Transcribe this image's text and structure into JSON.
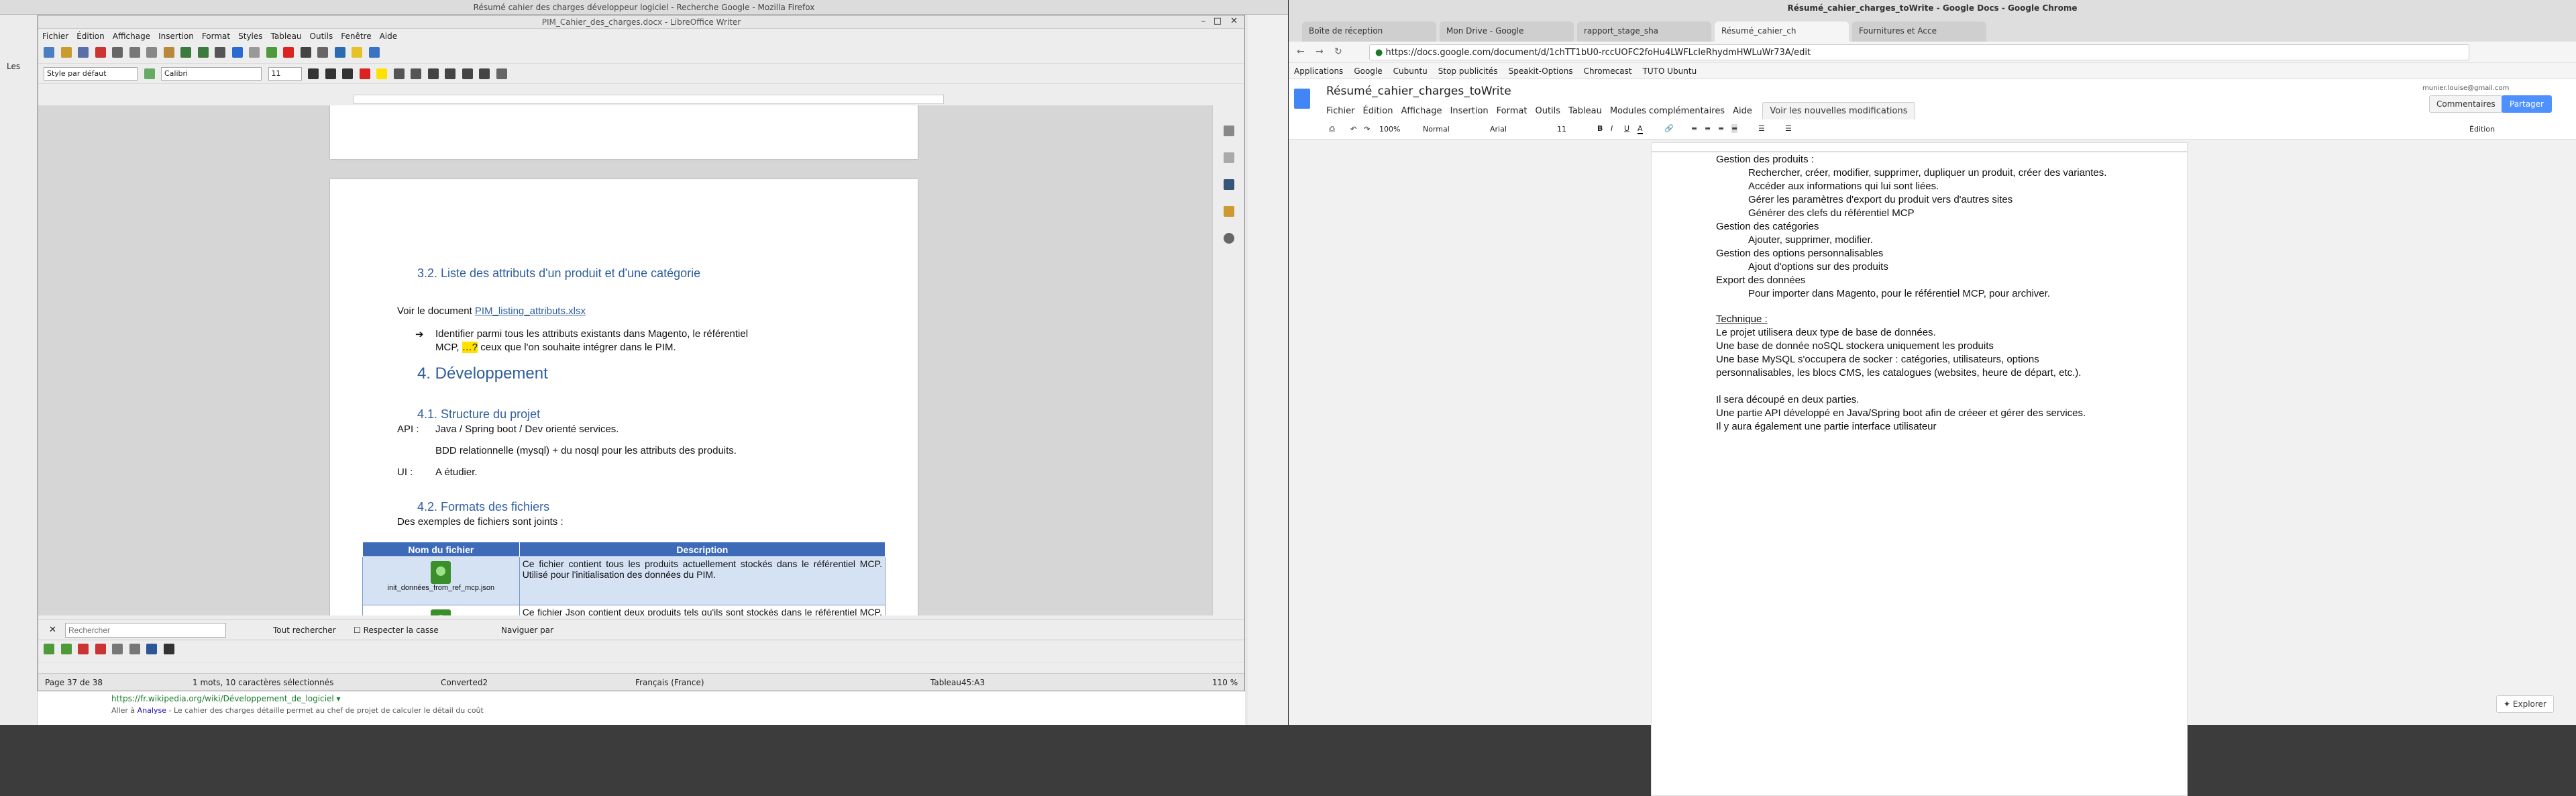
{
  "firefox": {
    "title": "Résumé cahier des charges développeur logiciel - Recherche Google - Mozilla Firefox",
    "sidebar_label": "Les",
    "result_url": "https://fr.wikipedia.org/wiki/Développement_de_logiciel ▾",
    "result_crumb_prefix": "Aller à",
    "result_crumb_link": "Analyse",
    "result_crumb_text": "- Le cahier des charges détaille permet au chef de projet de calculer le détail du coût"
  },
  "writer": {
    "title": "PIM_Cahier_des_charges.docx - LibreOffice Writer",
    "menu": [
      "Fichier",
      "Édition",
      "Affichage",
      "Insertion",
      "Format",
      "Styles",
      "Tableau",
      "Outils",
      "Fenêtre",
      "Aide"
    ],
    "style_value": "Style par défaut",
    "font_value": "Calibri",
    "size_value": "11",
    "doc": {
      "h_32": "3.2.        Liste des attributs d'un produit et d'une catégorie",
      "voir_prefix": "Voir le document ",
      "voir_link": "PIM_listing_attributs.xlsx",
      "arrow": "➔",
      "bullet_1": "Identifier parmi tous les attributs existants dans Magento, le référentiel",
      "bullet_2a": "MCP, ",
      "bullet_2b": "…?",
      "bullet_2c": " ceux que l'on souhaite intégrer dans le PIM.",
      "h_4": "4. Développement",
      "h_41": "4.1.        Structure du projet",
      "api_label": "API :",
      "api_text": "Java / Spring boot / Dev orienté services.",
      "bdd_text": "BDD relationnelle (mysql) + du nosql pour les attributs des produits.",
      "ui_label": "UI :",
      "ui_text": "A étudier.",
      "h_42": "4.2.        Formats des fichiers",
      "ex_text": "Des exemples de fichiers sont joints :",
      "table_headers": [
        "Nom du fichier",
        "Description"
      ],
      "row1_file": "init_données_from_ref_mcp.json",
      "row1_desc": "Ce fichier contient tous les produits actuellement stockés dans le référentiel MCP. Utilisé pour l'initialisation des données du PIM.",
      "row2_desc": "Ce fichier Json contient deux produits tels qu'ils sont stockés dans le référentiel MCP. Permet de connaitre"
    },
    "find": {
      "placeholder": "Rechercher",
      "all": "Tout rechercher",
      "case": "Respecter la casse",
      "nav": "Naviguer par"
    },
    "status": {
      "page": "Page 37 de 38",
      "words": "1 mots, 10 caractères sélectionnés",
      "style": "Converted2",
      "lang": "Français (France)",
      "cell": "Tableau45:A3",
      "zoom": "110 %"
    }
  },
  "chrome": {
    "title": "Résumé_cahier_charges_toWrite - Google Docs - Google Chrome",
    "tabs": [
      "Boîte de réception",
      "Mon Drive - Google",
      "rapport_stage_sha",
      "Résumé_cahier_ch",
      "Fournitures et Acce"
    ],
    "active_tab": 3,
    "url": "https://docs.google.com/document/d/1chTT1bU0-rccUOFC2foHu4LWFLcIeRhydmHWLuWr73A/edit",
    "bookmarks": [
      "Applications",
      "Google",
      "Cubuntu",
      "Stop publicités",
      "Speakit-Options",
      "Chromecast",
      "TUTO Ubuntu"
    ],
    "doc_title": "Résumé_cahier_charges_toWrite",
    "user": "munier.louise@gmail.com",
    "menu": [
      "Fichier",
      "Édition",
      "Affichage",
      "Insertion",
      "Format",
      "Outils",
      "Tableau",
      "Modules complémentaires",
      "Aide"
    ],
    "new_mods": "Voir les nouvelles modifications",
    "comments_btn": "Commentaires",
    "share_btn": "Partager",
    "toolbar": {
      "zoom": "100%",
      "style": "Normal",
      "font": "Arial",
      "size": "11",
      "mode": "Édition"
    },
    "explore": "Explorer",
    "lines": [
      {
        "t": "Gestion des produits :",
        "i": 0
      },
      {
        "t": "Rechercher, créer, modifier, supprimer, dupliquer un produit, créer des variantes.",
        "i": 1
      },
      {
        "t": "Accéder aux informations qui lui sont liées.",
        "i": 1
      },
      {
        "t": "Gérer les paramètres d'export du produit vers d'autres sites",
        "i": 1
      },
      {
        "t": "Générer des clefs du référentiel MCP",
        "i": 1
      },
      {
        "t": "Gestion des catégories",
        "i": 0
      },
      {
        "t": "Ajouter, supprimer, modifier.",
        "i": 1
      },
      {
        "t": "Gestion des options personnalisables",
        "i": 0
      },
      {
        "t": "Ajout d'options sur des produits",
        "i": 1
      },
      {
        "t": "Export des données",
        "i": 0
      },
      {
        "t": "Pour importer dans Magento, pour le référentiel MCP, pour archiver.",
        "i": 1
      }
    ],
    "tech_heading": "Technique :",
    "tech_lines": [
      "Le projet utilisera deux type de base de données.",
      "Une base de donnée noSQL stockera uniquement les produits",
      "Une base MySQL s'occupera de socker : catégories, utilisateurs, options",
      "personnalisables, les blocs CMS, les catalogues (websites, heure de départ, etc.).",
      "",
      "Il sera découpé en deux parties.",
      "Une partie API développé en Java/Spring boot afin de créeer et gérer des services.",
      "Il y aura également une partie interface utilisateur"
    ]
  }
}
